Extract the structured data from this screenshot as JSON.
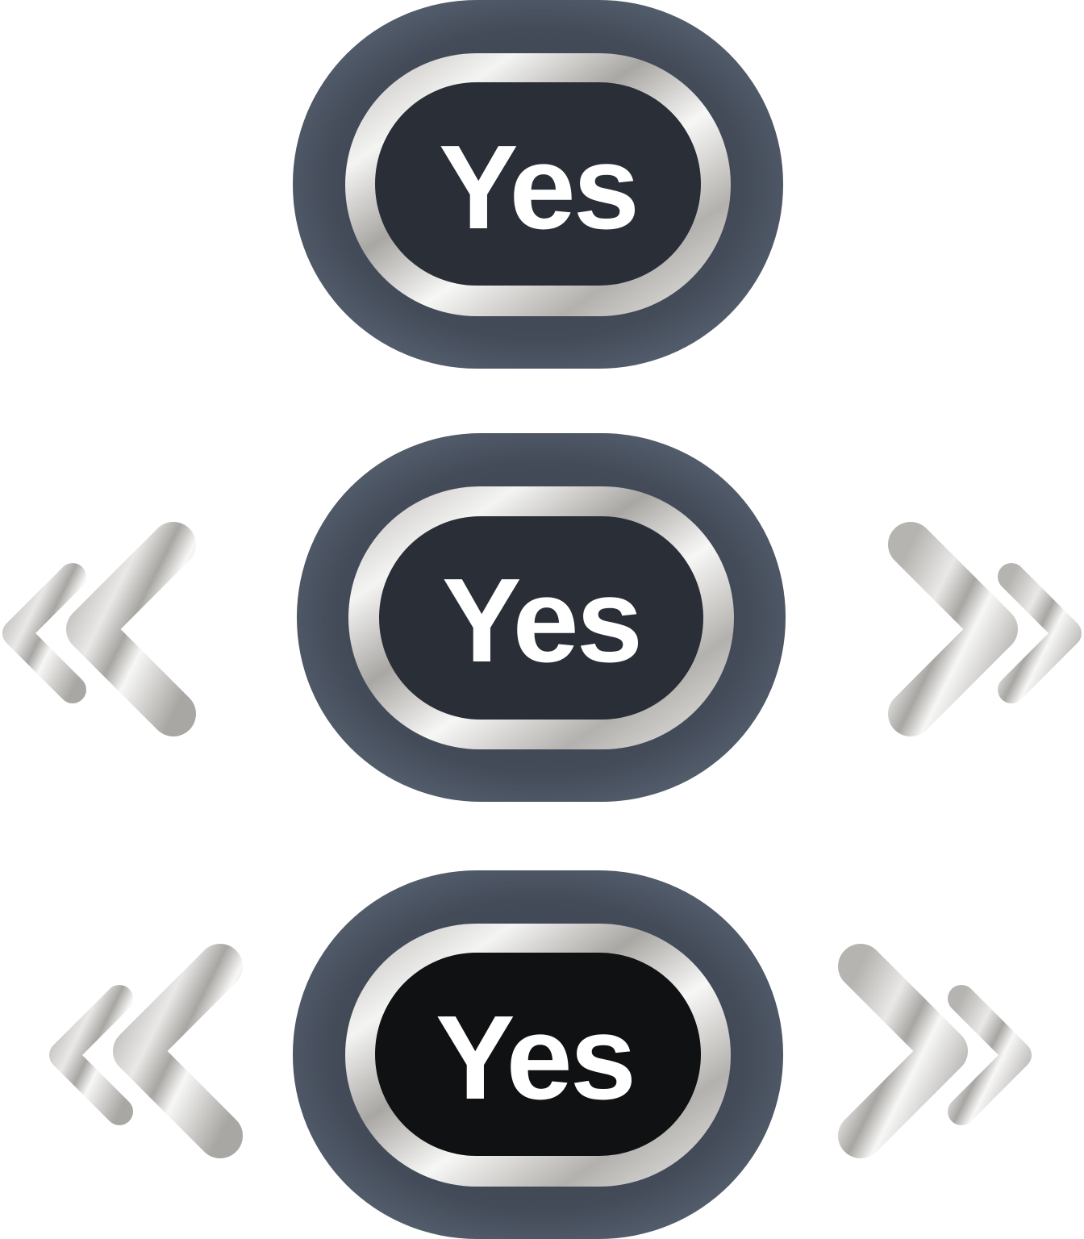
{
  "buttons": [
    {
      "label": "Yes",
      "variant": "plain",
      "face_color": "#2a2e37"
    },
    {
      "label": "Yes",
      "variant": "with-arrows",
      "face_color": "#2a2e37"
    },
    {
      "label": "Yes",
      "variant": "with-arrows",
      "face_color": "#0f1113"
    }
  ],
  "colors": {
    "outer_ring_dark": "#3b4350",
    "outer_ring_light": "#5a6472",
    "chrome_light": "#f5f5f3",
    "chrome_mid": "#bdbbb8",
    "background": "#ffffff"
  },
  "icons": {
    "left": "double-chevron-left-icon",
    "right": "double-chevron-right-icon"
  }
}
